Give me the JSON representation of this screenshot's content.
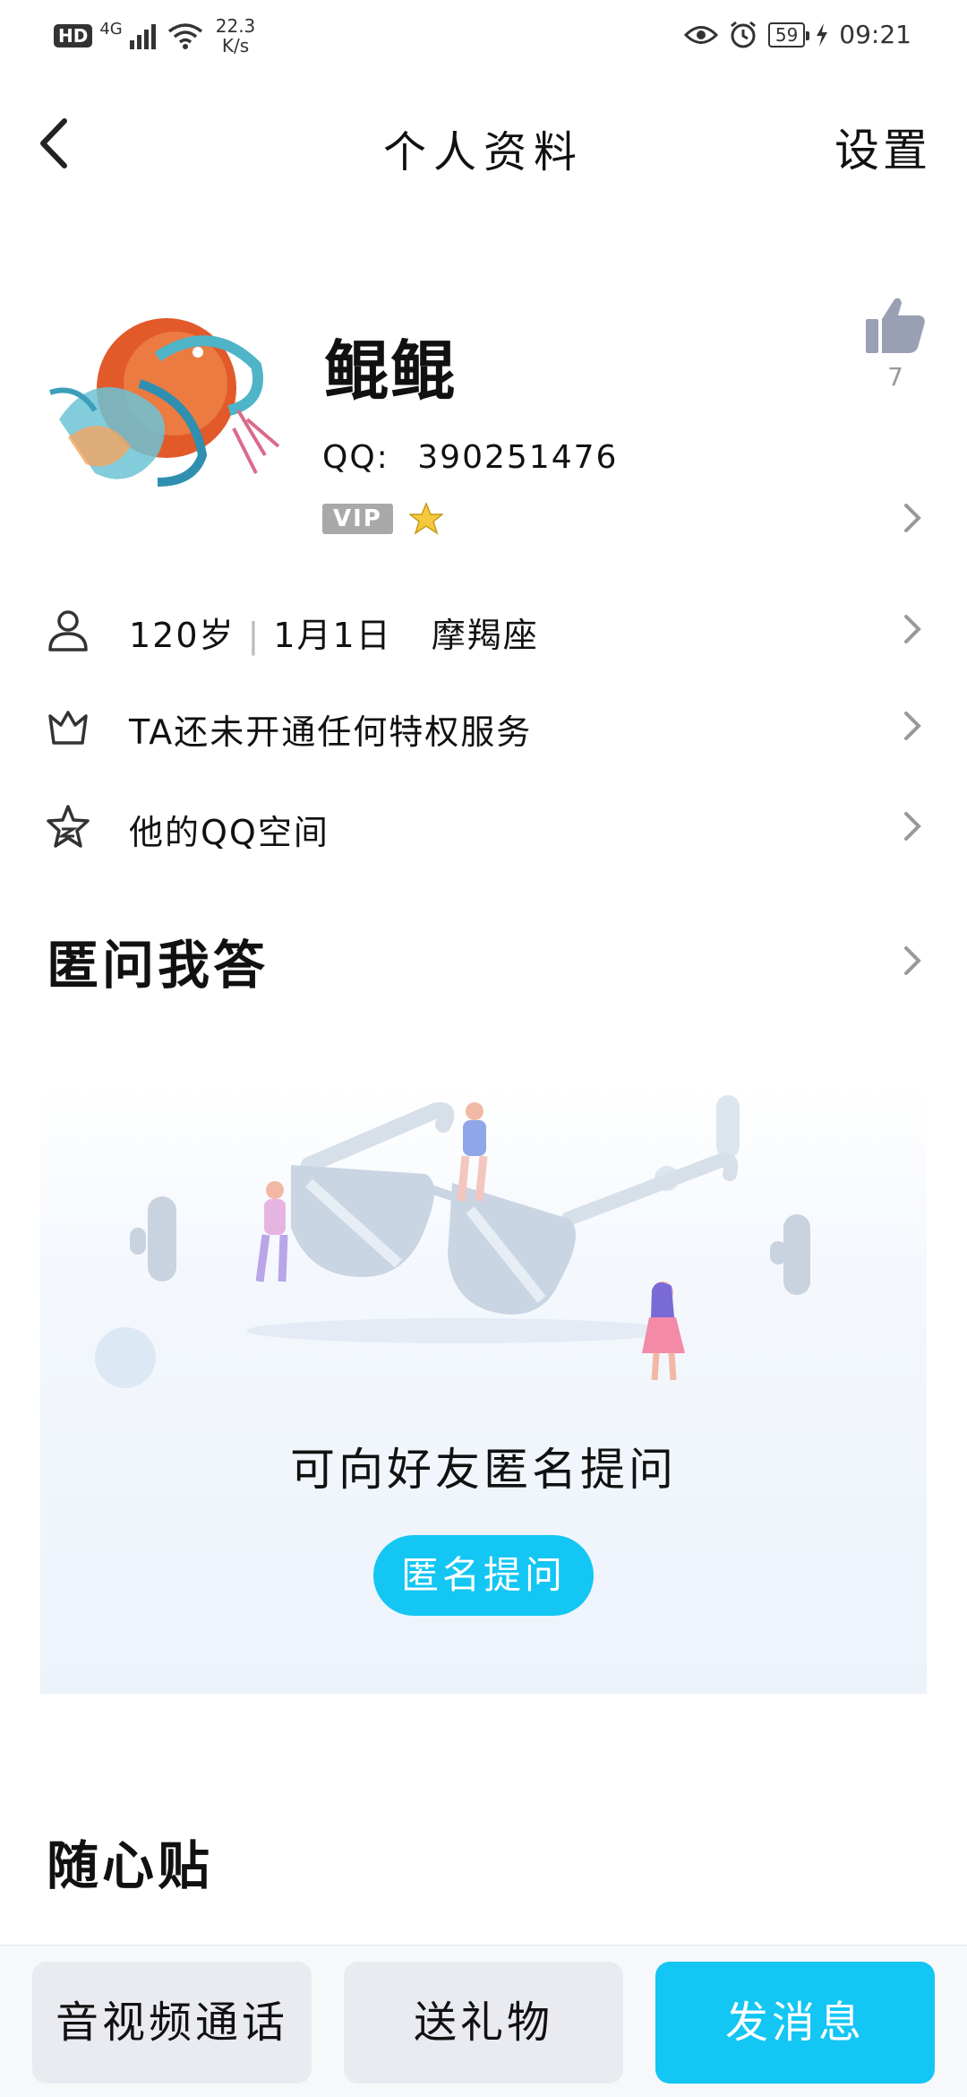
{
  "status_bar": {
    "hd": "HD",
    "network": "4G",
    "speed_value": "22.3",
    "speed_unit": "K/s",
    "battery": "59",
    "time": "09:21"
  },
  "nav": {
    "title": "个人资料",
    "settings": "设置"
  },
  "profile": {
    "nickname": "鲲鲲",
    "qq_label": "QQ:",
    "qq_number": "390251476",
    "vip_badge": "VIP",
    "likes": "7"
  },
  "info_rows": {
    "age": "120岁",
    "birthday": "1月1日",
    "zodiac": "摩羯座",
    "privilege": "TA还未开通任何特权服务",
    "qzone": "他的QQ空间"
  },
  "anon": {
    "title": "匿问我答",
    "prompt": "可向好友匿名提问",
    "button": "匿名提问"
  },
  "stickers": {
    "title": "随心贴"
  },
  "bottom_bar": {
    "call": "音视频通话",
    "gift": "送礼物",
    "message": "发消息"
  },
  "colors": {
    "accent": "#13c6f3",
    "grey_button": "#e9ebf1"
  }
}
